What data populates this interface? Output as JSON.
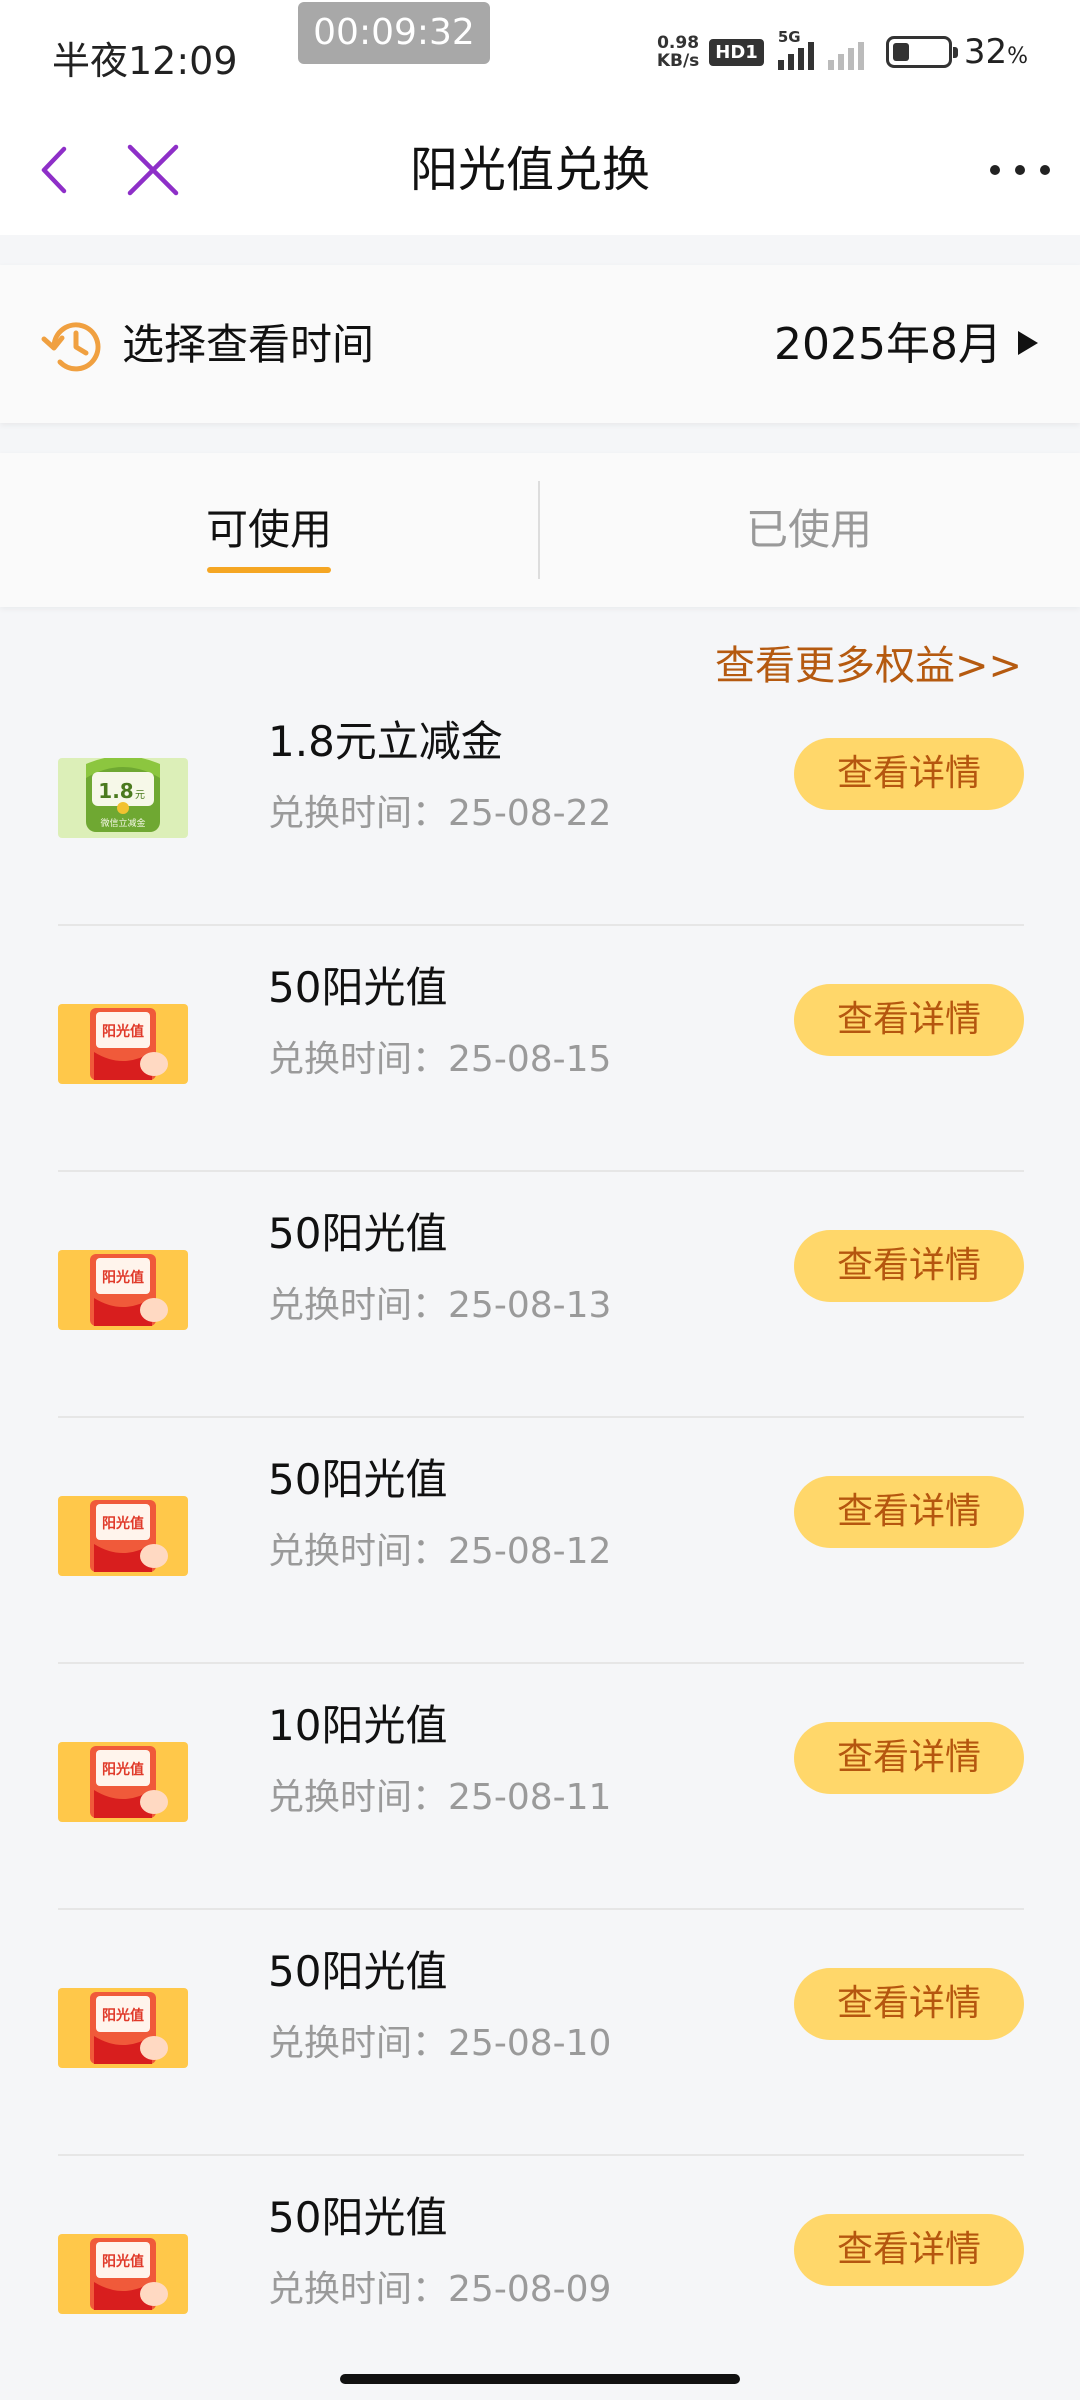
{
  "status_bar": {
    "time": "半夜12:09",
    "timer": "00:09:32",
    "net_speed_value": "0.98",
    "net_speed_unit": "KB/s",
    "hd_badge": "HD1",
    "network_type": "5G",
    "battery_percent": "32",
    "battery_unit": "%"
  },
  "nav": {
    "title": "阳光值兑换"
  },
  "month_selector": {
    "label": "选择查看时间",
    "value": "2025年8月"
  },
  "tabs": [
    {
      "label": "可使用",
      "active": true
    },
    {
      "label": "已使用",
      "active": false
    }
  ],
  "more_link": "查看更多权益>>",
  "records": [
    {
      "title": "1.8元立减金",
      "time_label": "兑换时间：",
      "time": "25-08-22",
      "button": "查看详情",
      "thumb": "coupon",
      "thumb_text": "1.8",
      "thumb_unit": "元",
      "thumb_caption": "微信立减金"
    },
    {
      "title": "50阳光值",
      "time_label": "兑换时间：",
      "time": "25-08-15",
      "button": "查看详情",
      "thumb": "sunshine",
      "thumb_text": "阳光值"
    },
    {
      "title": "50阳光值",
      "time_label": "兑换时间：",
      "time": "25-08-13",
      "button": "查看详情",
      "thumb": "sunshine",
      "thumb_text": "阳光值"
    },
    {
      "title": "50阳光值",
      "time_label": "兑换时间：",
      "time": "25-08-12",
      "button": "查看详情",
      "thumb": "sunshine",
      "thumb_text": "阳光值"
    },
    {
      "title": "10阳光值",
      "time_label": "兑换时间：",
      "time": "25-08-11",
      "button": "查看详情",
      "thumb": "sunshine",
      "thumb_text": "阳光值"
    },
    {
      "title": "50阳光值",
      "time_label": "兑换时间：",
      "time": "25-08-10",
      "button": "查看详情",
      "thumb": "sunshine",
      "thumb_text": "阳光值"
    },
    {
      "title": "50阳光值",
      "time_label": "兑换时间：",
      "time": "25-08-09",
      "button": "查看详情",
      "thumb": "sunshine",
      "thumb_text": "阳光值"
    }
  ],
  "colors": {
    "accent_purple": "#8e2fc8",
    "tab_underline": "#f5a623",
    "button_bg": "#ffd76a",
    "button_text": "#b5560f",
    "link_text": "#b55a10"
  }
}
